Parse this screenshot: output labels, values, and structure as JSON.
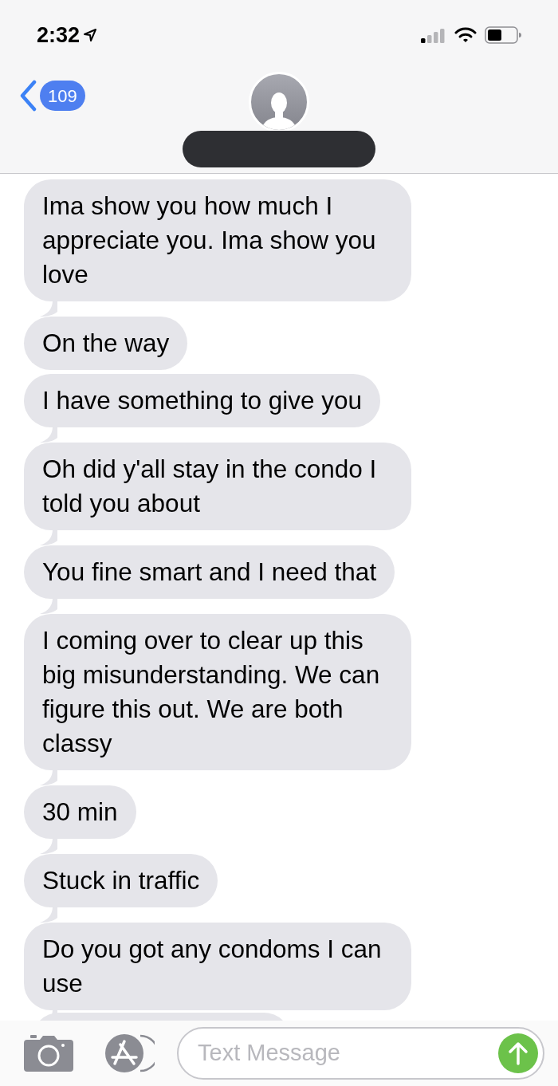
{
  "status_bar": {
    "time": "2:32"
  },
  "nav": {
    "back_count": "109"
  },
  "messages": [
    {
      "text": "Ima show you how much I appreciate you. Ima show you love",
      "tail": true
    },
    {
      "text": "On the way",
      "tail": false
    },
    {
      "text": "I have something to give you",
      "tail": true
    },
    {
      "text": "Oh did y'all stay in the condo I told you about",
      "tail": true
    },
    {
      "text": "You fine smart and I need that",
      "tail": true
    },
    {
      "text": "I coming over to clear up this big misunderstanding. We can figure this out. We are both classy",
      "tail": true
    },
    {
      "text": "30 min",
      "tail": true
    },
    {
      "text": "Stuck in traffic",
      "tail": true
    },
    {
      "text": "Do you got any condoms I can use",
      "tail": true
    }
  ],
  "composer": {
    "placeholder": "Text Message"
  }
}
